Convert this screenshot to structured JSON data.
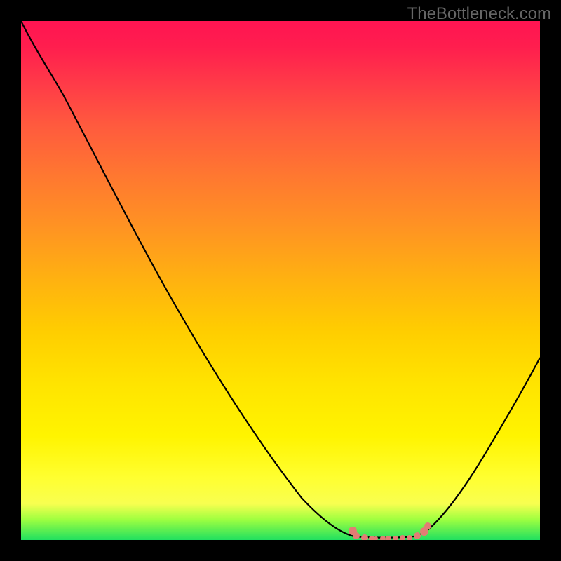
{
  "watermark": "TheBottleneck.com",
  "chart_data": {
    "type": "line",
    "title": "",
    "xlabel": "",
    "ylabel": "",
    "x": [
      0,
      5,
      10,
      15,
      20,
      25,
      30,
      35,
      40,
      45,
      50,
      55,
      60,
      62,
      65,
      70,
      75,
      78,
      80,
      82,
      85,
      90,
      95,
      100
    ],
    "values": [
      100,
      96,
      90,
      82,
      74,
      66,
      58,
      50,
      42,
      34,
      26,
      18,
      10,
      6,
      2,
      0.5,
      0.2,
      0.2,
      1,
      3,
      8,
      16,
      24,
      32
    ],
    "ylim": [
      0,
      100
    ],
    "xlim": [
      0,
      100
    ],
    "annotations": {
      "salmon_dots_x_range": [
        62,
        80
      ],
      "description": "V-shaped curve descending from top-left to a minimum near x≈73, then rising. Small salmon-colored dots mark the bottom of the valley."
    },
    "background": "vertical gradient red→orange→yellow→green",
    "grid": false
  }
}
